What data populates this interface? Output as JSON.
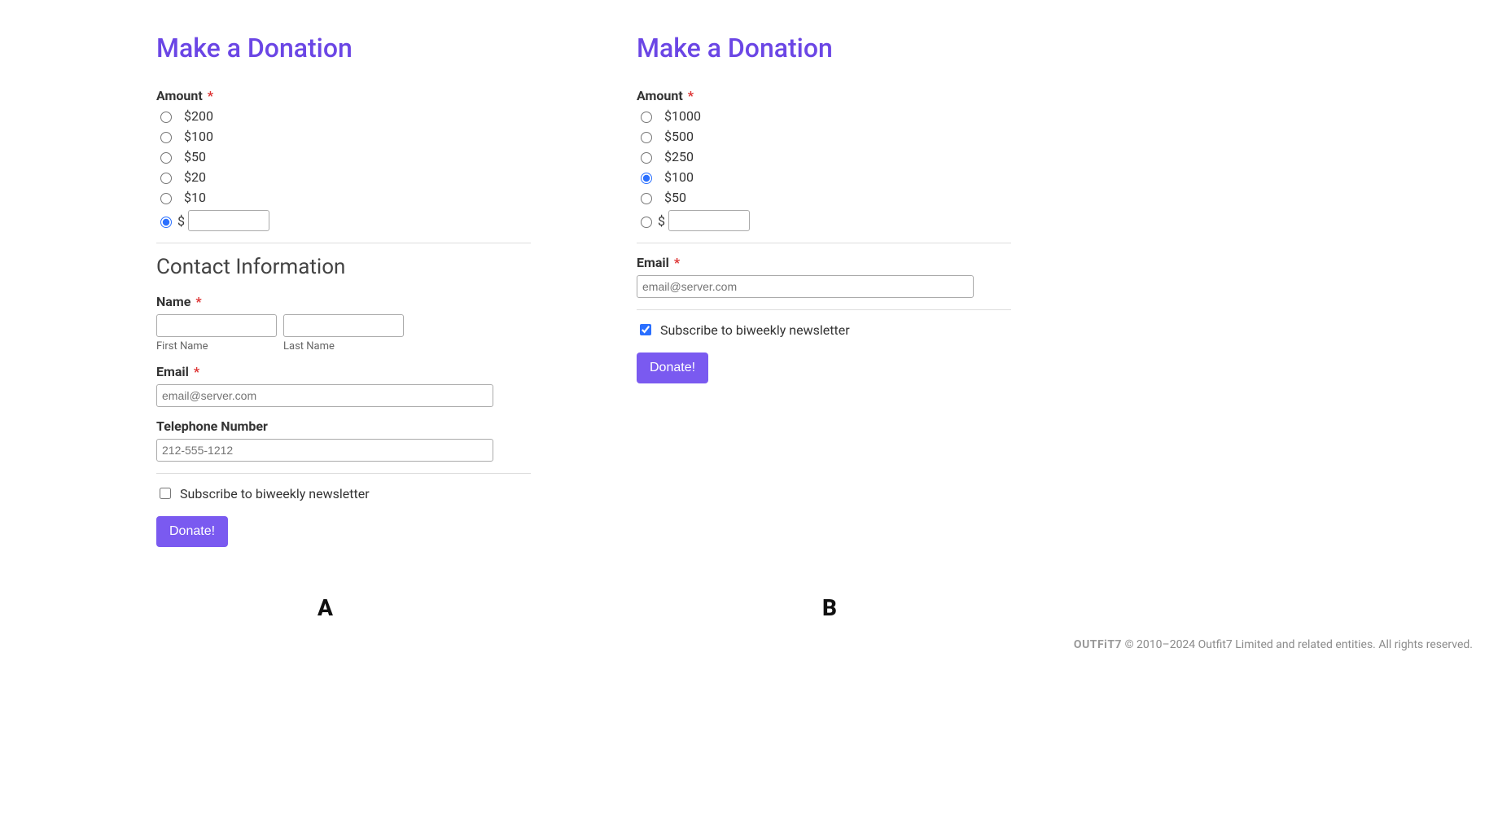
{
  "formA": {
    "title": "Make a Donation",
    "amount": {
      "label": "Amount",
      "options": [
        "$200",
        "$100",
        "$50",
        "$20",
        "$10"
      ],
      "customPrefix": "$",
      "selected": "custom"
    },
    "contactHeading": "Contact Information",
    "name": {
      "label": "Name",
      "firstSub": "First Name",
      "lastSub": "Last Name"
    },
    "email": {
      "label": "Email",
      "placeholder": "email@server.com"
    },
    "phone": {
      "label": "Telephone Number",
      "placeholder": "212-555-1212"
    },
    "subscribe": {
      "label": "Subscribe to biweekly newsletter",
      "checked": false
    },
    "submit": "Donate!"
  },
  "formB": {
    "title": "Make a Donation",
    "amount": {
      "label": "Amount",
      "options": [
        "$1000",
        "$500",
        "$250",
        "$100",
        "$50"
      ],
      "customPrefix": "$",
      "selected": 3
    },
    "email": {
      "label": "Email",
      "placeholder": "email@server.com"
    },
    "subscribe": {
      "label": "Subscribe to biweekly newsletter",
      "checked": true
    },
    "submit": "Donate!"
  },
  "panelLabels": {
    "a": "A",
    "b": "B"
  },
  "footer": {
    "brand": "OUTFiT7",
    "text": "© 2010–2024 Outfit7 Limited and related entities. All rights reserved."
  }
}
